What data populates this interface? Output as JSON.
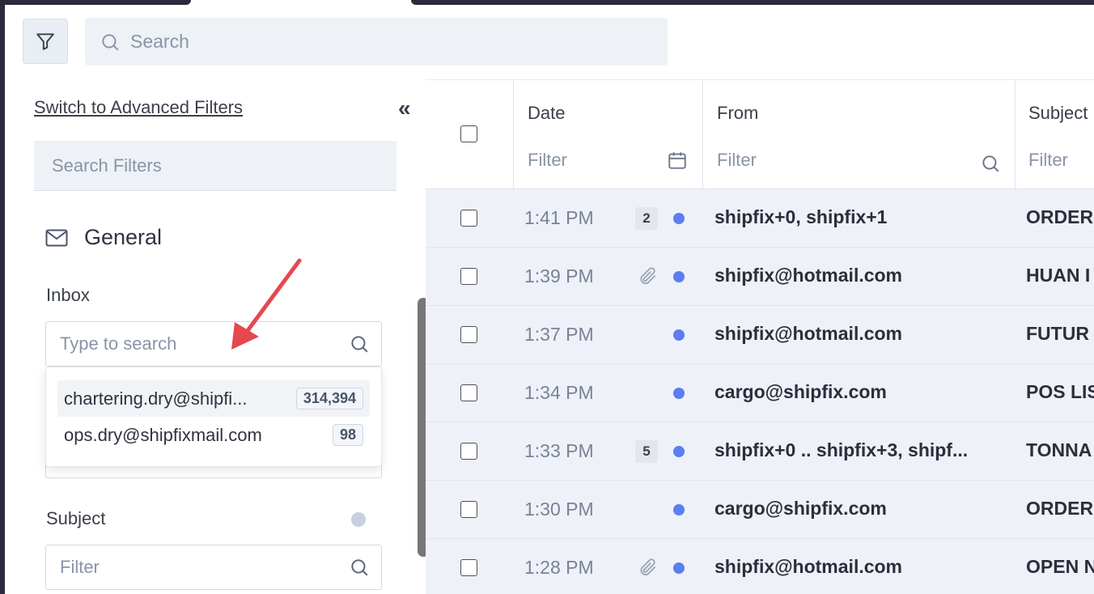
{
  "toolbar": {
    "search_placeholder": "Search"
  },
  "sidebar": {
    "advanced_link": "Switch to Advanced Filters",
    "collapse_label": "«",
    "search_filters_placeholder": "Search Filters",
    "section_title": "General",
    "inbox": {
      "label": "Inbox",
      "placeholder": "Type to search",
      "options": [
        {
          "email": "chartering.dry@shipfi...",
          "count": "314,394"
        },
        {
          "email": "ops.dry@shipfixmail.com",
          "count": "98"
        }
      ]
    },
    "subject": {
      "label": "Subject",
      "placeholder": "Filter"
    }
  },
  "table": {
    "columns": {
      "date": {
        "title": "Date",
        "placeholder": "Filter"
      },
      "from": {
        "title": "From",
        "placeholder": "Filter"
      },
      "subject": {
        "title": "Subject",
        "placeholder": "Filter"
      }
    },
    "rows": [
      {
        "time": "1:41 PM",
        "count": "2",
        "from": "shipfix+0, shipfix+1",
        "subject": "ORDER"
      },
      {
        "time": "1:39 PM",
        "from": "shipfix@hotmail.com",
        "subject": "HUAN I"
      },
      {
        "time": "1:37 PM",
        "from": "shipfix@hotmail.com",
        "subject": "FUTUR"
      },
      {
        "time": "1:34 PM",
        "from": "cargo@shipfix.com",
        "subject": "POS LIS"
      },
      {
        "time": "1:33 PM",
        "count": "5",
        "from": "shipfix+0 .. shipfix+3, shipf...",
        "subject": "TONNA"
      },
      {
        "time": "1:30 PM",
        "from": "cargo@shipfix.com",
        "subject": "ORDER"
      },
      {
        "time": "1:28 PM",
        "from": "shipfix@hotmail.com",
        "subject": "OPEN N"
      }
    ]
  },
  "colors": {
    "unread_dot": "#5b7ef0",
    "table_bg": "#eef1f8",
    "annotation_arrow": "#e5484d"
  }
}
